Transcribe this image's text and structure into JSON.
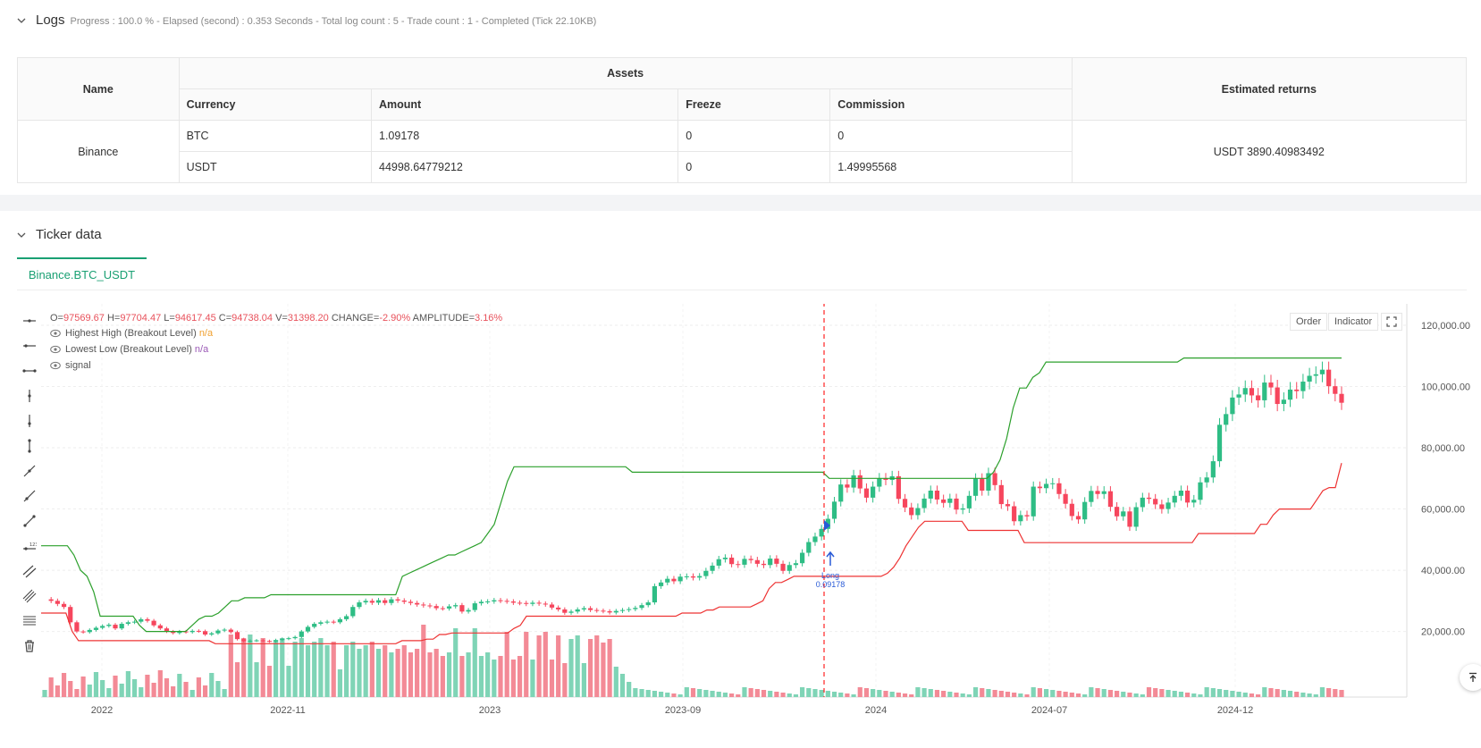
{
  "logs": {
    "title": "Logs",
    "status": "Progress : 100.0 % - Elapsed (second) : 0.353  Seconds - Total log count : 5 - Trade count : 1 - Completed (Tick 22.10KB)"
  },
  "assets_table": {
    "name_header": "Name",
    "assets_header": "Assets",
    "returns_header": "Estimated returns",
    "columns": [
      "Currency",
      "Amount",
      "Freeze",
      "Commission"
    ],
    "exchange": "Binance",
    "rows": [
      {
        "currency": "BTC",
        "amount": "1.09178",
        "freeze": "0",
        "commission": "0"
      },
      {
        "currency": "USDT",
        "amount": "44998.64779212",
        "freeze": "0",
        "commission": "1.49995568"
      }
    ],
    "estimated_returns": "USDT 3890.40983492"
  },
  "ticker": {
    "title": "Ticker data",
    "tab_label": "Binance.BTC_USDT"
  },
  "ohlc": {
    "o_label": "O=",
    "o": "97569.67",
    "h_label": "H=",
    "h": "97704.47",
    "l_label": "L=",
    "l": "94617.45",
    "c_label": "C=",
    "c": "94738.04",
    "v_label": "V=",
    "v": "31398.20",
    "change_label": "CHANGE=",
    "change": "-2.90%",
    "amp_label": "AMPLITUDE=",
    "amp": "3.16%"
  },
  "legend": [
    {
      "label": "Highest High (Breakout Level)",
      "value": "n/a",
      "color": "#f0a030"
    },
    {
      "label": "Lowest Low (Breakout Level)",
      "value": "n/a",
      "color": "#9b59b6"
    },
    {
      "label": "signal",
      "value": "",
      "color": "#555"
    }
  ],
  "buttons": {
    "order": "Order",
    "indicator": "Indicator"
  },
  "trade_marker": {
    "label": "Long",
    "qty": "0.09178"
  },
  "colors": {
    "up": "#26a69a",
    "up_fill": "#2ebd85",
    "down": "#f6465d",
    "hh_line": "#2ca02c",
    "ll_line": "#ee3333",
    "accent": "#1aa073"
  },
  "chart_data": {
    "type": "line",
    "title": "",
    "y_ticks": [
      "120,000.00",
      "100,000.00",
      "80,000.00",
      "60,000.00",
      "40,000.00",
      "20,000.00"
    ],
    "y_tick_values": [
      120000,
      100000,
      80000,
      60000,
      40000,
      20000
    ],
    "x_ticks": [
      "2022",
      "2022-11",
      "2023",
      "2023-09",
      "2024",
      "2024-07",
      "2024-12"
    ],
    "ylim": [
      5000,
      127000
    ],
    "series": [
      {
        "name": "Highest High (Breakout Level)",
        "values": [
          48000,
          48000,
          48000,
          48000,
          48000,
          45000,
          40000,
          38000,
          33000,
          25000,
          25000,
          25000,
          25000,
          25000,
          25000,
          22000,
          20000,
          20000,
          20000,
          20000,
          20000,
          20000,
          20000,
          22000,
          24000,
          25000,
          25000,
          26000,
          28000,
          30000,
          30000,
          31000,
          31000,
          31000,
          31000,
          32000,
          32000,
          32000,
          32000,
          32000,
          32000,
          32000,
          32000,
          32000,
          32000,
          32000,
          32000,
          32000,
          32000,
          32000,
          32000,
          32000,
          32000,
          32000,
          32000,
          38000,
          39000,
          40000,
          41000,
          42000,
          43000,
          44000,
          45000,
          45000,
          46000,
          47000,
          48000,
          49000,
          52000,
          55000,
          62000,
          69000,
          73800,
          73800,
          73800,
          73800,
          73800,
          73800,
          73800,
          73800,
          73800,
          73800,
          73800,
          73800,
          73800,
          73800,
          73800,
          73800,
          73800,
          73800,
          72000,
          72000,
          72000,
          72000,
          72000,
          72000,
          72000,
          72000,
          72000,
          72000,
          72000,
          72000,
          72000,
          72000,
          72000,
          72000,
          72000,
          72000,
          72000,
          72000,
          72000,
          72000,
          72000,
          72000,
          72000,
          72000,
          72000,
          72000,
          72000,
          72000,
          70000,
          70000,
          70000,
          70000,
          70000,
          70000,
          70000,
          70000,
          70000,
          70000,
          70000,
          70000,
          70000,
          70000,
          70000,
          70000,
          70000,
          70000,
          70000,
          70000,
          70000,
          70000,
          70000,
          70000,
          70000,
          72000,
          76000,
          83000,
          93000,
          99500,
          99500,
          103000,
          104500,
          108000,
          108000,
          108000,
          108000,
          108000,
          108000,
          108000,
          108000,
          108000,
          108000,
          108000,
          108000,
          108000,
          108000,
          108000,
          108000,
          108000,
          108000,
          108000,
          108000,
          108000,
          109300,
          109300,
          109300,
          109300,
          109300,
          109300,
          109300,
          109300,
          109300,
          109300,
          109300,
          109300,
          109300,
          109300,
          109300,
          109300,
          109300,
          109300,
          109300,
          109300,
          109300,
          109300,
          109300,
          109300,
          109300
        ]
      },
      {
        "name": "Lowest Low (Breakout Level)",
        "values": [
          26000,
          26000,
          26000,
          26000,
          26000,
          20000,
          17000,
          17000,
          17000,
          17000,
          17000,
          17000,
          17000,
          17000,
          17000,
          17000,
          17000,
          17000,
          17000,
          17000,
          17000,
          17000,
          17000,
          17000,
          17000,
          17000,
          17000,
          17000,
          16000,
          16000,
          16000,
          16000,
          16000,
          16000,
          16000,
          16000,
          16000,
          16000,
          16000,
          16000,
          16000,
          16000,
          16000,
          16000,
          16000,
          16000,
          16000,
          16000,
          16000,
          16000,
          16000,
          16000,
          16000,
          16000,
          16000,
          16000,
          16000,
          16000,
          17000,
          17000,
          17000,
          17000,
          17500,
          17500,
          19000,
          19000,
          19500,
          19500,
          19500,
          19500,
          19500,
          19500,
          19500,
          19500,
          19500,
          19500,
          21000,
          22000,
          25000,
          25000,
          25000,
          25000,
          25000,
          25000,
          25000,
          25000,
          25000,
          25000,
          25000,
          25000,
          25000,
          25000,
          25000,
          25000,
          25000,
          25000,
          25000,
          25000,
          25000,
          25000,
          25000,
          25000,
          25000,
          26000,
          26000,
          26000,
          26000,
          27000,
          27000,
          28000,
          28000,
          28000,
          28000,
          28000,
          28000,
          29000,
          30000,
          34000,
          36000,
          36000,
          37000,
          38000,
          38000,
          38000,
          38000,
          38000,
          38000,
          38000,
          38000,
          38000,
          38000,
          38000,
          38000,
          38000,
          38000,
          38000,
          39000,
          41000,
          44000,
          48000,
          51000,
          54000,
          56000,
          56000,
          56000,
          56000,
          56000,
          56000,
          56000,
          53000,
          53000,
          53000,
          53000,
          53000,
          53000,
          53000,
          53000,
          53000,
          49000,
          49000,
          49000,
          49000,
          49000,
          49000,
          49000,
          49000,
          49000,
          49000,
          49000,
          49000,
          49000,
          49000,
          49000,
          49000,
          49000,
          49000,
          49000,
          49000,
          49000,
          49000,
          49000,
          49000,
          49000,
          49000,
          49000,
          49000,
          52000,
          52000,
          52000,
          52000,
          52000,
          52000,
          52000,
          52000,
          52000,
          52000,
          55000,
          55000,
          58000,
          60000,
          60000,
          60000,
          60000,
          60000,
          60000,
          63000,
          66000,
          67000,
          67000,
          75000
        ]
      }
    ],
    "price_path": [
      30500,
      30000,
      29000,
      28000,
      23000,
      20000,
      19800,
      20500,
      21200,
      21800,
      22200,
      21000,
      22500,
      23000,
      23200,
      24000,
      23500,
      22000,
      21000,
      20000,
      19500,
      20000,
      19800,
      20200,
      20100,
      19000,
      19400,
      20300,
      20600,
      19800,
      17500,
      16800,
      17000,
      17100,
      16900,
      16700,
      17200,
      17600,
      17800,
      18200,
      20000,
      21500,
      22500,
      23000,
      23200,
      23000,
      24000,
      25000,
      28000,
      29500,
      30000,
      29400,
      30200,
      29300,
      30500,
      30100,
      29700,
      29300,
      28800,
      28500,
      28300,
      27600,
      27500,
      28200,
      28600,
      26500,
      27000,
      29200,
      29700,
      29800,
      30200,
      30000,
      29800,
      29400,
      29300,
      29000,
      29400,
      29100,
      28800,
      27800,
      27200,
      26100,
      26500,
      27200,
      27600,
      27000,
      26800,
      26600,
      26200,
      26700,
      27000,
      27300,
      27700,
      28600,
      29500,
      34800,
      36000,
      37200,
      36400,
      37900,
      38000,
      37600,
      38100,
      39800,
      41500,
      43600,
      44100,
      42000,
      41800,
      43700,
      43300,
      42100,
      41700,
      43800,
      42100,
      39800,
      41700,
      42300,
      45700,
      49200,
      51000,
      53500,
      56800,
      62400,
      68000,
      67000,
      71000,
      66700,
      63700,
      67300,
      70000,
      69500,
      70700,
      63300,
      60500,
      58000,
      60300,
      63400,
      66000,
      63100,
      62000,
      63400,
      59800,
      60200,
      64300,
      69900,
      66000,
      71700,
      67800,
      61600,
      60900,
      56000,
      58000,
      57600,
      67300,
      66800,
      68200,
      68400,
      64900,
      61700,
      57700,
      56600,
      62300,
      65900,
      64900,
      65800,
      60700,
      57600,
      59200,
      54200,
      60600,
      63700,
      63300,
      61500,
      60000,
      62100,
      64300,
      66000,
      62100,
      63000,
      68700,
      70300,
      75600,
      87500,
      91000,
      96400,
      97400,
      99500,
      97100,
      95500,
      101300,
      99700,
      94300,
      95700,
      99000,
      98500,
      101600,
      103500,
      104000,
      105500,
      100100,
      97600,
      94700
    ],
    "trade": {
      "side": "Long",
      "qty": "0.09178",
      "date_index": 124
    }
  }
}
